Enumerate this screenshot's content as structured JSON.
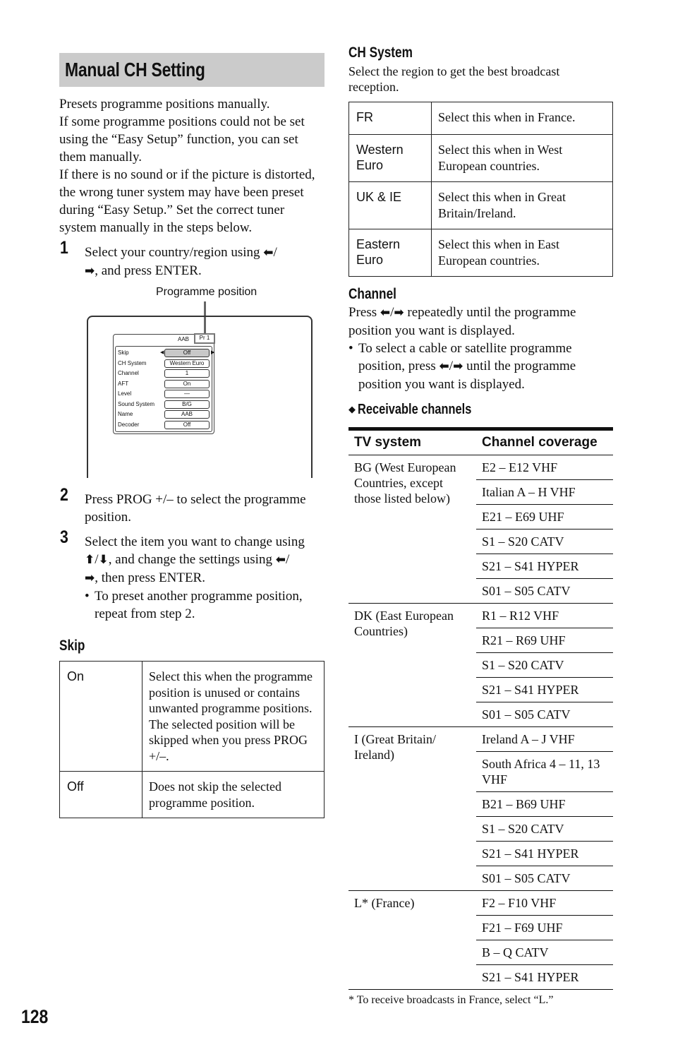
{
  "page": {
    "title": "Manual CH Setting",
    "page_number": "128"
  },
  "intro": [
    "Presets programme positions manually.",
    "If some programme positions could not be set using the “Easy Setup” function, you can set them manually.",
    "If there is no sound or if the picture is distorted, the wrong tuner system may have been preset during “Easy Setup.” Set the correct tuner system manually in the steps below."
  ],
  "icons": {
    "left": "⬅",
    "right": "➡",
    "up": "⬆",
    "down": "⬇",
    "diamond": "◆"
  },
  "steps": [
    {
      "num": "1",
      "text_a": "Select your country/region using ",
      "text_b": "/",
      "text_c": ", and press ENTER."
    },
    {
      "num": "2",
      "text": "Press PROG +/– to select the programme position."
    },
    {
      "num": "3",
      "text_a": "Select the item you want to change using ",
      "text_b": "/",
      "text_c": ", and change the settings using ",
      "text_d": "/",
      "text_e": ", then press ENTER.",
      "bullet": "To preset another programme position, repeat from step 2."
    }
  ],
  "diagram": {
    "callout": "Programme position",
    "osd_name": "AAB",
    "osd_pr": "Pr 1",
    "rows": [
      {
        "label": "Skip",
        "value": "Off"
      },
      {
        "label": "CH System",
        "value": "Western Euro"
      },
      {
        "label": "Channel",
        "value": "1"
      },
      {
        "label": "AFT",
        "value": "On"
      },
      {
        "label": "Level",
        "value": "—"
      },
      {
        "label": "Sound System",
        "value": "B/G"
      },
      {
        "label": "Name",
        "value": "AAB"
      },
      {
        "label": "Decoder",
        "value": "Off"
      }
    ]
  },
  "skip": {
    "heading": "Skip",
    "rows": [
      {
        "key": "On",
        "desc": "Select this when the programme position is unused or contains unwanted programme positions.\nThe selected position will be skipped when you press PROG +/–."
      },
      {
        "key": "Off",
        "desc": "Does not skip the selected programme position."
      }
    ]
  },
  "ch_system": {
    "heading": "CH System",
    "description": "Select the region to get the best broadcast reception.",
    "rows": [
      {
        "key": "FR",
        "desc": "Select this when in France."
      },
      {
        "key": "Western Euro",
        "desc": "Select this when in West European countries."
      },
      {
        "key": "UK & IE",
        "desc": "Select this when in Great Britain/Ireland."
      },
      {
        "key": "Eastern Euro",
        "desc": "Select this when in East European countries."
      }
    ]
  },
  "channel": {
    "heading": "Channel",
    "text_a": "Press ",
    "text_b": "/",
    "text_c": " repeatedly until the programme position you want is displayed.",
    "bullet_a": "To select a cable or satellite programme position, press ",
    "bullet_b": "/",
    "bullet_c": " until the programme position you want is displayed."
  },
  "receivable": {
    "heading": "Receivable channels",
    "columns": [
      "TV system",
      "Channel coverage"
    ],
    "groups": [
      {
        "system": "BG (West European Countries, except those listed below)",
        "coverage": [
          "E2 – E12 VHF",
          "Italian A – H VHF",
          "E21 – E69 UHF",
          "S1 – S20 CATV",
          "S21 – S41 HYPER",
          "S01 – S05 CATV"
        ]
      },
      {
        "system": "DK (East European Countries)",
        "coverage": [
          "R1 – R12 VHF",
          "R21 – R69 UHF",
          "S1 – S20 CATV",
          "S21 – S41 HYPER",
          "S01 – S05 CATV"
        ]
      },
      {
        "system": "I (Great Britain/ Ireland)",
        "coverage": [
          "Ireland A – J VHF",
          "South Africa 4 – 11, 13 VHF",
          "B21 – B69 UHF",
          "S1 – S20 CATV",
          "S21 – S41 HYPER",
          "S01 – S05 CATV"
        ]
      },
      {
        "system": "L* (France)",
        "coverage": [
          "F2 – F10 VHF",
          "F21 – F69 UHF",
          "B – Q CATV",
          "S21 – S41 HYPER"
        ]
      }
    ],
    "footnote": "* To receive broadcasts in France, select “L.”"
  }
}
